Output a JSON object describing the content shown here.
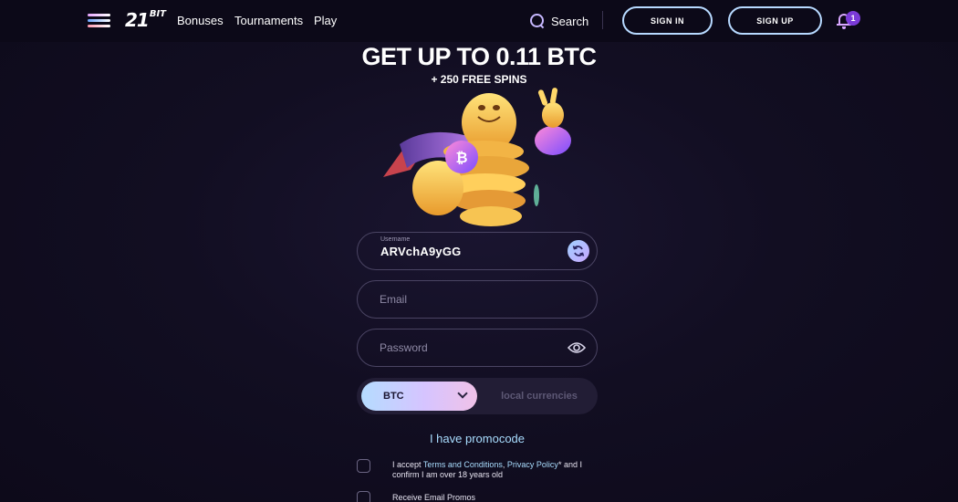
{
  "header": {
    "logo_main": "21",
    "logo_suffix": "BIT",
    "nav": [
      "Bonuses",
      "Tournaments",
      "Play"
    ],
    "search_label": "Search",
    "sign_in": "SIGN IN",
    "sign_up": "SIGN UP",
    "notification_count": "1"
  },
  "hero": {
    "title": "GET UP TO 0.11 BTC",
    "subtitle": "+ 250 FREE SPINS"
  },
  "form": {
    "username_label": "Username",
    "username_value": "ARVchA9yGG",
    "email_placeholder": "Email",
    "password_placeholder": "Password",
    "currency_selected": "BTC",
    "currency_alt": "local currencies",
    "promocode": "I have promocode",
    "terms_prefix": "I accept ",
    "terms_link": "Terms and Conditions",
    "terms_sep": ", ",
    "privacy_link": "Privacy Policy",
    "terms_suffix": "* and I confirm I am over 18 years old",
    "email_promos": "Receive Email Promos"
  },
  "colors": {
    "background": "#100c1f",
    "accent_light_blue": "#b7d9ff",
    "link_blue": "#a9ddff",
    "badge_purple": "#7b3bd8"
  }
}
